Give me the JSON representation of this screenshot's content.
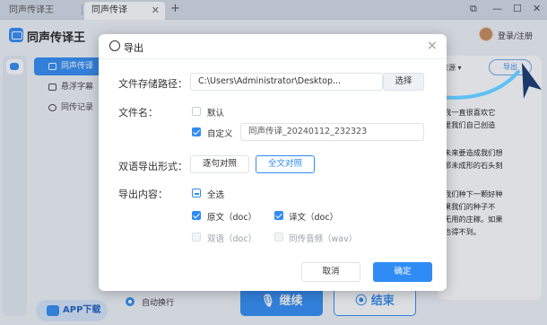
{
  "tabs": [
    {
      "label": "同声传译王"
    },
    {
      "label": "同声传译"
    }
  ],
  "tab_close": "✕",
  "tab_add": "+",
  "window_controls": {
    "pin": "⧉",
    "minimize": "—",
    "maximize": "☐",
    "close": "✕"
  },
  "app": {
    "name": "同声传译王",
    "login": "登录/注册"
  },
  "sidebar": {
    "items": [
      {
        "label": "同声传译",
        "icon": "headset-icon",
        "active": true
      },
      {
        "label": "悬浮字幕",
        "icon": "subtitle-icon",
        "active": false
      },
      {
        "label": "同传记录",
        "icon": "history-icon",
        "active": false
      }
    ],
    "app_download": "APP下载"
  },
  "right_panel": {
    "source_label": "来源",
    "export_label": "导出",
    "text_lines": [
      "我一直很喜欢它",
      "里我们自己创造",
      "",
      "未来要造成我们想",
      "那未成形的石头刻",
      "",
      "我们种下一颗好种",
      "果我们的种子不",
      "无用的庄稼。如果",
      "也得不到。"
    ]
  },
  "bottom": {
    "auto_wrap": "自动换行",
    "continue": "继续",
    "end": "结束"
  },
  "dialog": {
    "title": "导出",
    "close": "×",
    "path_label": "文件存储路径：",
    "path_value": "C:\\Users\\Administrator\\Desktop...",
    "choose_button": "选择",
    "filename_label": "文件名：",
    "default_option": "默认",
    "custom_option": "自定义",
    "custom_name": "同声传译_20240112_232323",
    "bilingual_label": "双语导出形式：",
    "bilingual_modes": [
      "逐句对照",
      "全文对照"
    ],
    "content_label": "导出内容：",
    "select_all": "全选",
    "content_options": [
      {
        "label": "原文（doc）",
        "checked": true,
        "disabled": false
      },
      {
        "label": "译文（doc）",
        "checked": true,
        "disabled": false
      },
      {
        "label": "双语（doc）",
        "checked": false,
        "disabled": true
      },
      {
        "label": "同传音频（wav）",
        "checked": false,
        "disabled": true
      }
    ],
    "cancel": "取消",
    "confirm": "确定"
  },
  "colors": {
    "accent": "#2f8cf5",
    "background": "#f1f4f8"
  }
}
